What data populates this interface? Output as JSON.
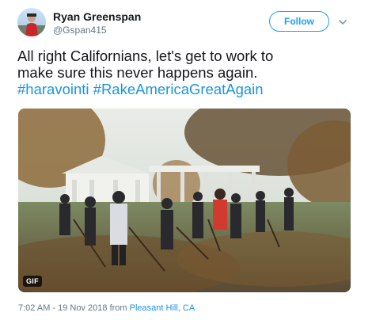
{
  "author": {
    "name": "Ryan Greenspan",
    "handle": "@Gspan415"
  },
  "follow_button": "Follow",
  "tweet": {
    "text_lines": [
      "All right Californians, let's get to work to",
      "make sure this never happens again."
    ],
    "hashtags": [
      "#haravointi",
      "#RakeAmericaGreatAgain"
    ]
  },
  "media": {
    "badge": "GIF"
  },
  "meta": {
    "timestamp": "7:02 AM - 19 Nov 2018",
    "from_label": "from",
    "location": "Pleasant Hill, CA"
  },
  "colors": {
    "link": "#1b95e0",
    "follow": "#1da1f2",
    "secondary_text": "#657786"
  }
}
